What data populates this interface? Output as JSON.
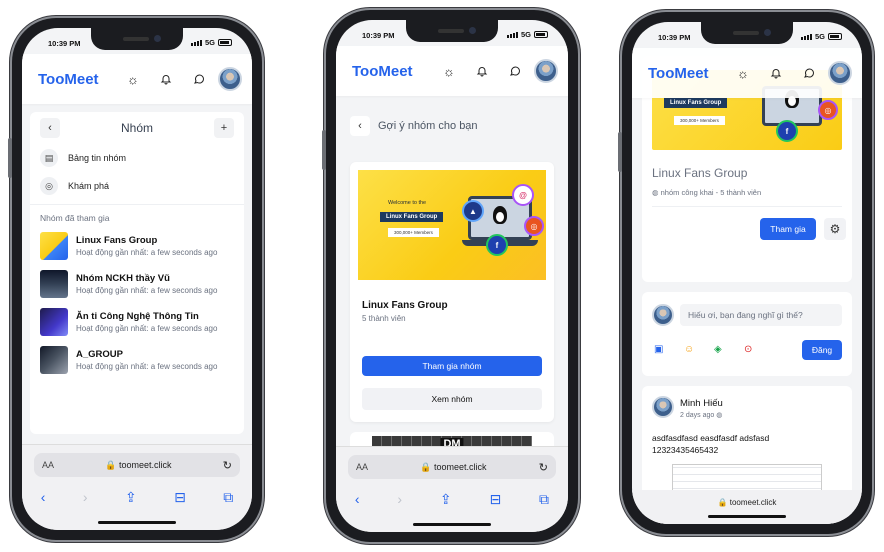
{
  "status": {
    "time": "10:39 PM",
    "network": "5G"
  },
  "app": {
    "logo": "TooMeet"
  },
  "browser": {
    "aa": "AA",
    "url": "toomeet.click"
  },
  "phone1": {
    "title": "Nhóm",
    "menu": [
      {
        "label": "Bảng tin nhóm",
        "icon": "newsfeed-icon"
      },
      {
        "label": "Khám phá",
        "icon": "compass-icon"
      }
    ],
    "joined_label": "Nhóm đã tham gia",
    "groups": [
      {
        "name": "Linux Fans Group",
        "activity": "Hoạt động gần nhất: a few seconds ago",
        "color": "#facc15"
      },
      {
        "name": "Nhóm NCKH thầy Vũ",
        "activity": "Hoạt động gần nhất: a few seconds ago",
        "color": "#1f2937"
      },
      {
        "name": "Ăn ti Công Nghệ Thông Tin",
        "activity": "Hoạt động gần nhất: a few seconds ago",
        "color": "#4338ca"
      },
      {
        "name": "A_GROUP",
        "activity": "Hoạt động gần nhất: a few seconds ago",
        "color": "#374151"
      }
    ]
  },
  "phone2": {
    "back_label": "Gợi ý nhóm cho bạn",
    "banner": {
      "welcome": "Welcome to the",
      "tag": "Linux Fans Group",
      "members": "300,000+ Members"
    },
    "group_name": "Linux Fans Group",
    "members": "5 thành viên",
    "join_button": "Tham gia nhóm",
    "view_button": "Xem nhóm",
    "next_card_text": "DM"
  },
  "phone3": {
    "banner": {
      "tag": "Linux Fans Group",
      "members": "300,000+ Members"
    },
    "group_name": "Linux Fans Group",
    "meta": "nhóm công khai - 5 thành viên",
    "join_button": "Tham gia",
    "post_placeholder": "Hiếu ơi, bạn đang nghĩ gì thế?",
    "post_button": "Đăng",
    "post": {
      "author": "Minh Hiếu",
      "time": "2 days ago",
      "lines": [
        "asdfasdfasd easdfasdf adsfasd",
        "12323435465432"
      ]
    }
  },
  "colors": {
    "accent": "#2563eb",
    "banner": "#facc15"
  }
}
